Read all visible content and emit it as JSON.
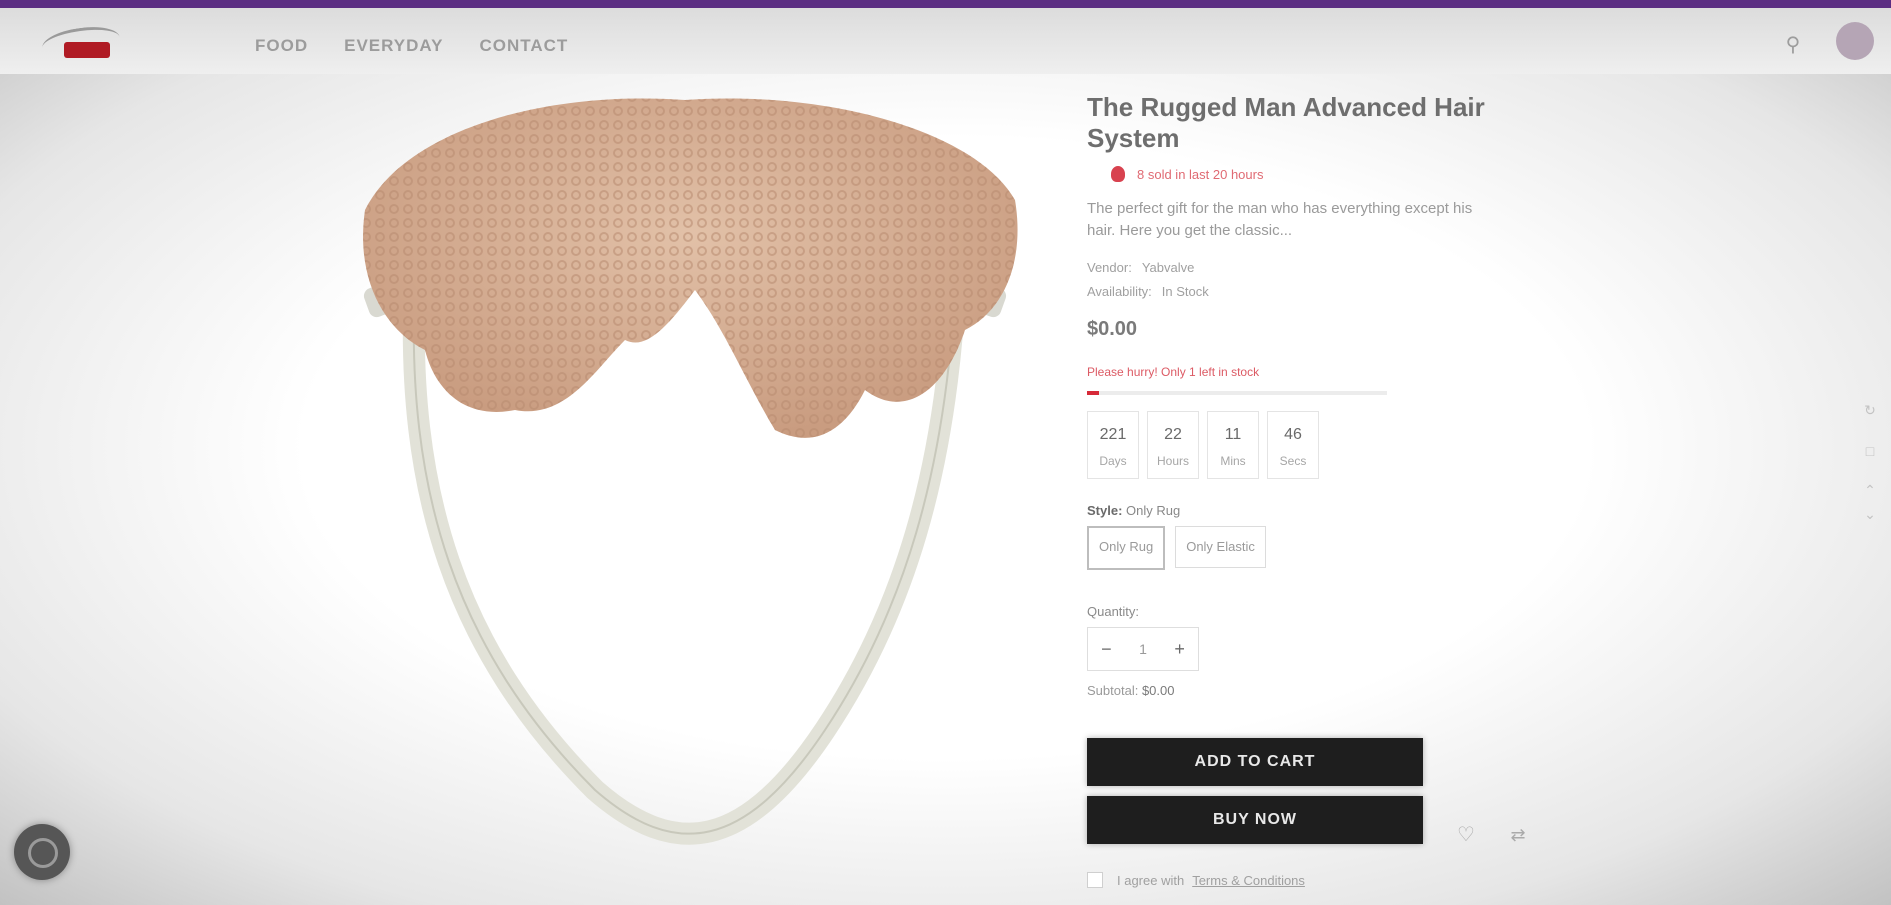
{
  "header": {
    "nav": [
      "FOOD",
      "EVERYDAY",
      "CONTACT"
    ],
    "icons": [
      "search-icon",
      "account-icon"
    ]
  },
  "product": {
    "title": "The Rugged Man Advanced Hair System",
    "sold_text": "8 sold in last 20 hours",
    "description": "The perfect gift for the man who has everything except his hair. Here you get the classic...",
    "vendor_label": "Vendor:",
    "vendor": "Yabvalve",
    "availability_label": "Availability:",
    "availability": "In Stock",
    "price": "$0.00",
    "hurry_text": "Please hurry! Only 1 left in stock",
    "stock_fraction": 0.04,
    "countdown": [
      {
        "num": "221",
        "unit": "Days"
      },
      {
        "num": "22",
        "unit": "Hours"
      },
      {
        "num": "11",
        "unit": "Mins"
      },
      {
        "num": "46",
        "unit": "Secs"
      }
    ],
    "style_label": "Style:",
    "style_value": "Only Rug",
    "options": [
      "Only Rug",
      "Only Elastic"
    ],
    "quantity_label": "Quantity:",
    "quantity": "1",
    "subtotal_label": "Subtotal:",
    "subtotal": "$0.00",
    "add_to_cart": "ADD TO CART",
    "buy_now": "BUY NOW",
    "agree_text": "I agree with",
    "terms_link": "Terms & Conditions"
  },
  "colors": {
    "top_strip": "#5b2d82",
    "button": "#1e1e1e",
    "accent_red": "#d62a38"
  }
}
